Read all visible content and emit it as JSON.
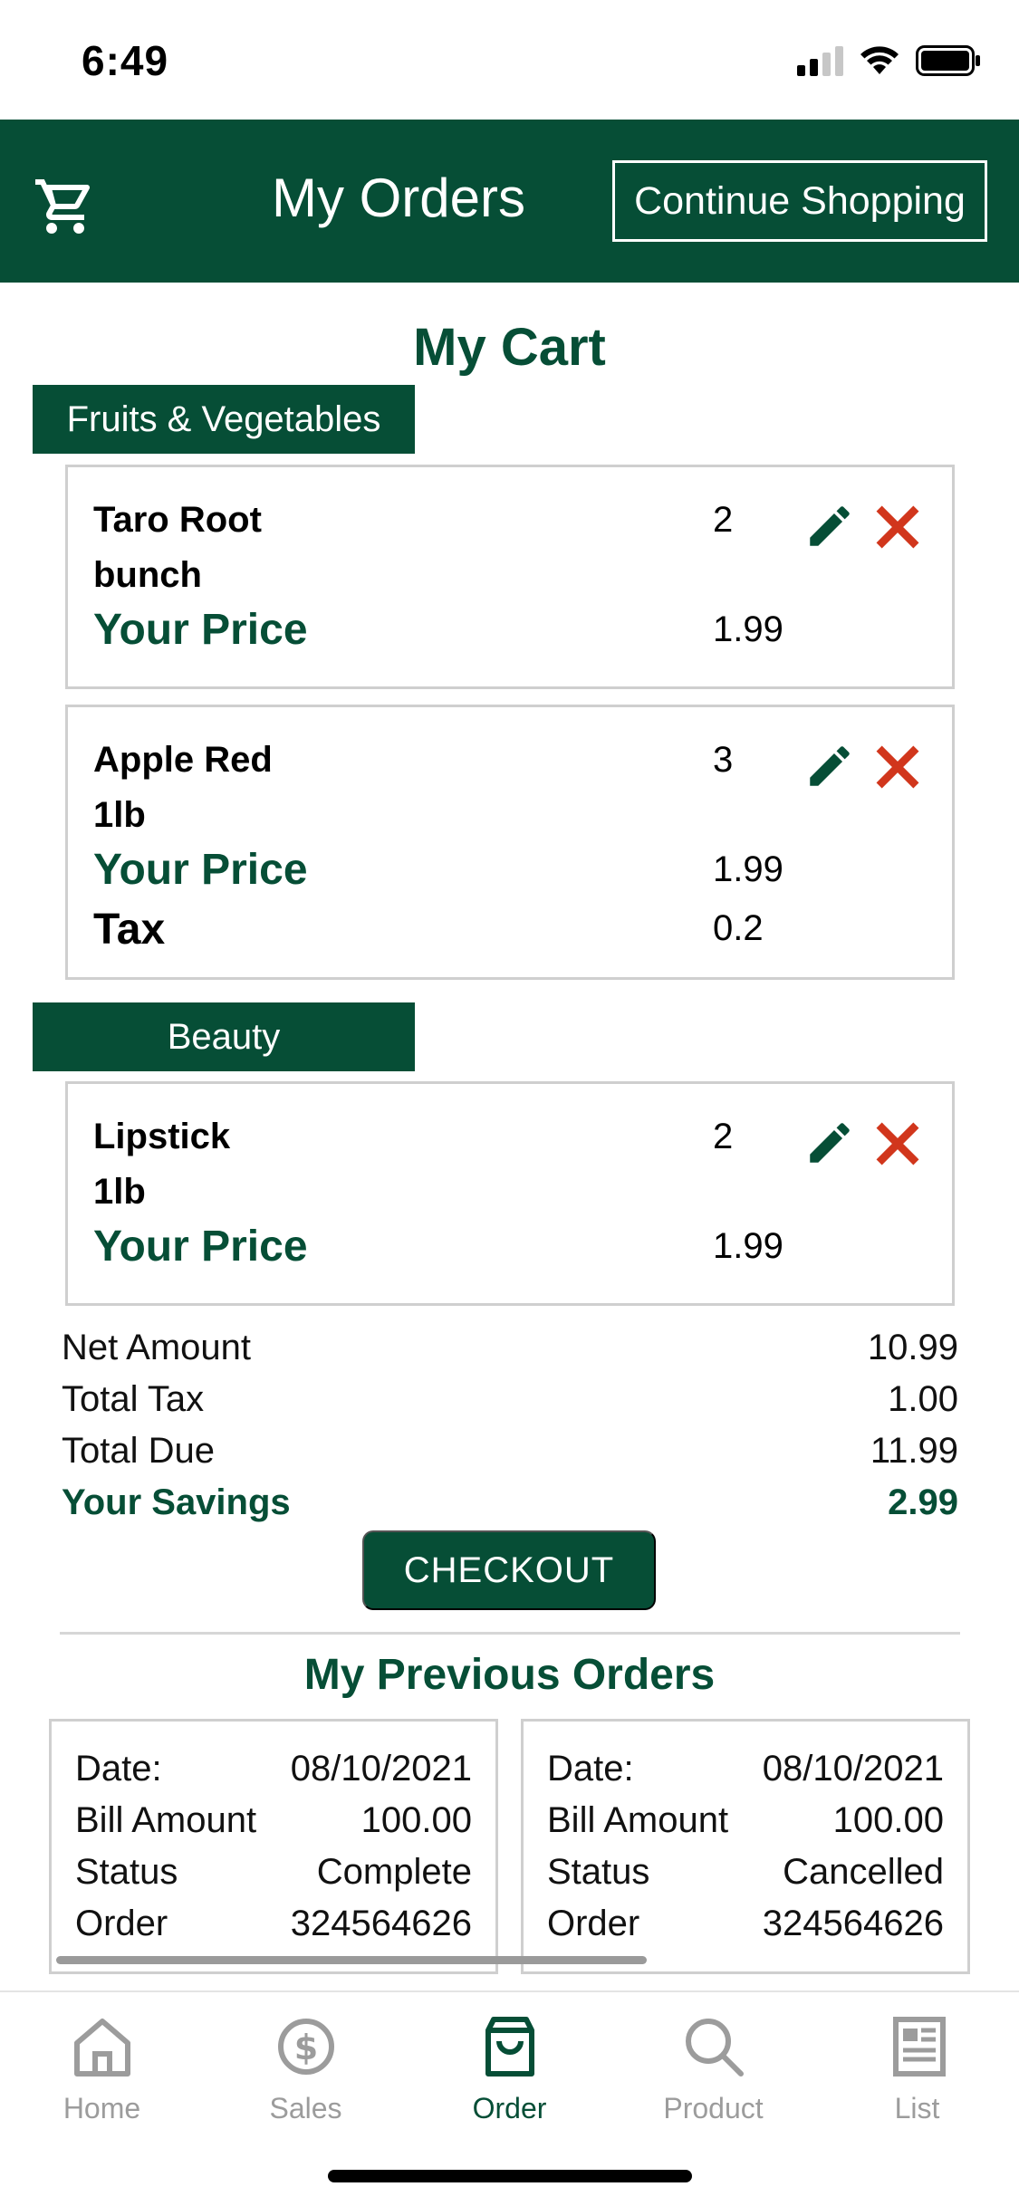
{
  "status_bar": {
    "time": "6:49"
  },
  "header": {
    "title": "My Orders",
    "continue_label": "Continue Shopping"
  },
  "cart": {
    "title": "My Cart",
    "categories": [
      {
        "name": "Fruits & Vegetables",
        "items": [
          {
            "name": "Taro Root",
            "unit": "bunch",
            "qty": "2",
            "price_label": "Your Price",
            "price": "1.99"
          },
          {
            "name": "Apple Red",
            "unit": "1lb",
            "qty": "3",
            "price_label": "Your Price",
            "price": "1.99",
            "tax_label": "Tax",
            "tax": "0.2"
          }
        ]
      },
      {
        "name": "Beauty",
        "items": [
          {
            "name": "Lipstick",
            "unit": "1lb",
            "qty": "2",
            "price_label": "Your Price",
            "price": "1.99"
          }
        ]
      }
    ]
  },
  "totals": {
    "net_label": "Net Amount",
    "net": "10.99",
    "tax_label": "Total Tax",
    "tax": "1.00",
    "due_label": "Total Due",
    "due": "11.99",
    "savings_label": "Your Savings",
    "savings": "2.99"
  },
  "checkout_label": "CHECKOUT",
  "previous_orders": {
    "title": "My Previous Orders",
    "labels": {
      "date": "Date:",
      "bill": "Bill Amount",
      "status": "Status",
      "order": "Order"
    },
    "orders": [
      {
        "date": "08/10/2021",
        "bill": "100.00",
        "status": "Complete",
        "order": "324564626"
      },
      {
        "date": "08/10/2021",
        "bill": "100.00",
        "status": "Cancelled",
        "order": "324564626"
      }
    ]
  },
  "tabs": [
    {
      "label": "Home",
      "icon": "home-icon",
      "active": false
    },
    {
      "label": "Sales",
      "icon": "dollar-icon",
      "active": false
    },
    {
      "label": "Order",
      "icon": "shopping-bag-icon",
      "active": true
    },
    {
      "label": "Product",
      "icon": "search-icon",
      "active": false
    },
    {
      "label": "List",
      "icon": "list-icon",
      "active": false
    }
  ],
  "colors": {
    "brand": "#064e36",
    "delete": "#d1361c",
    "inactive": "#9c9c9c",
    "border": "#cfcfcf"
  }
}
